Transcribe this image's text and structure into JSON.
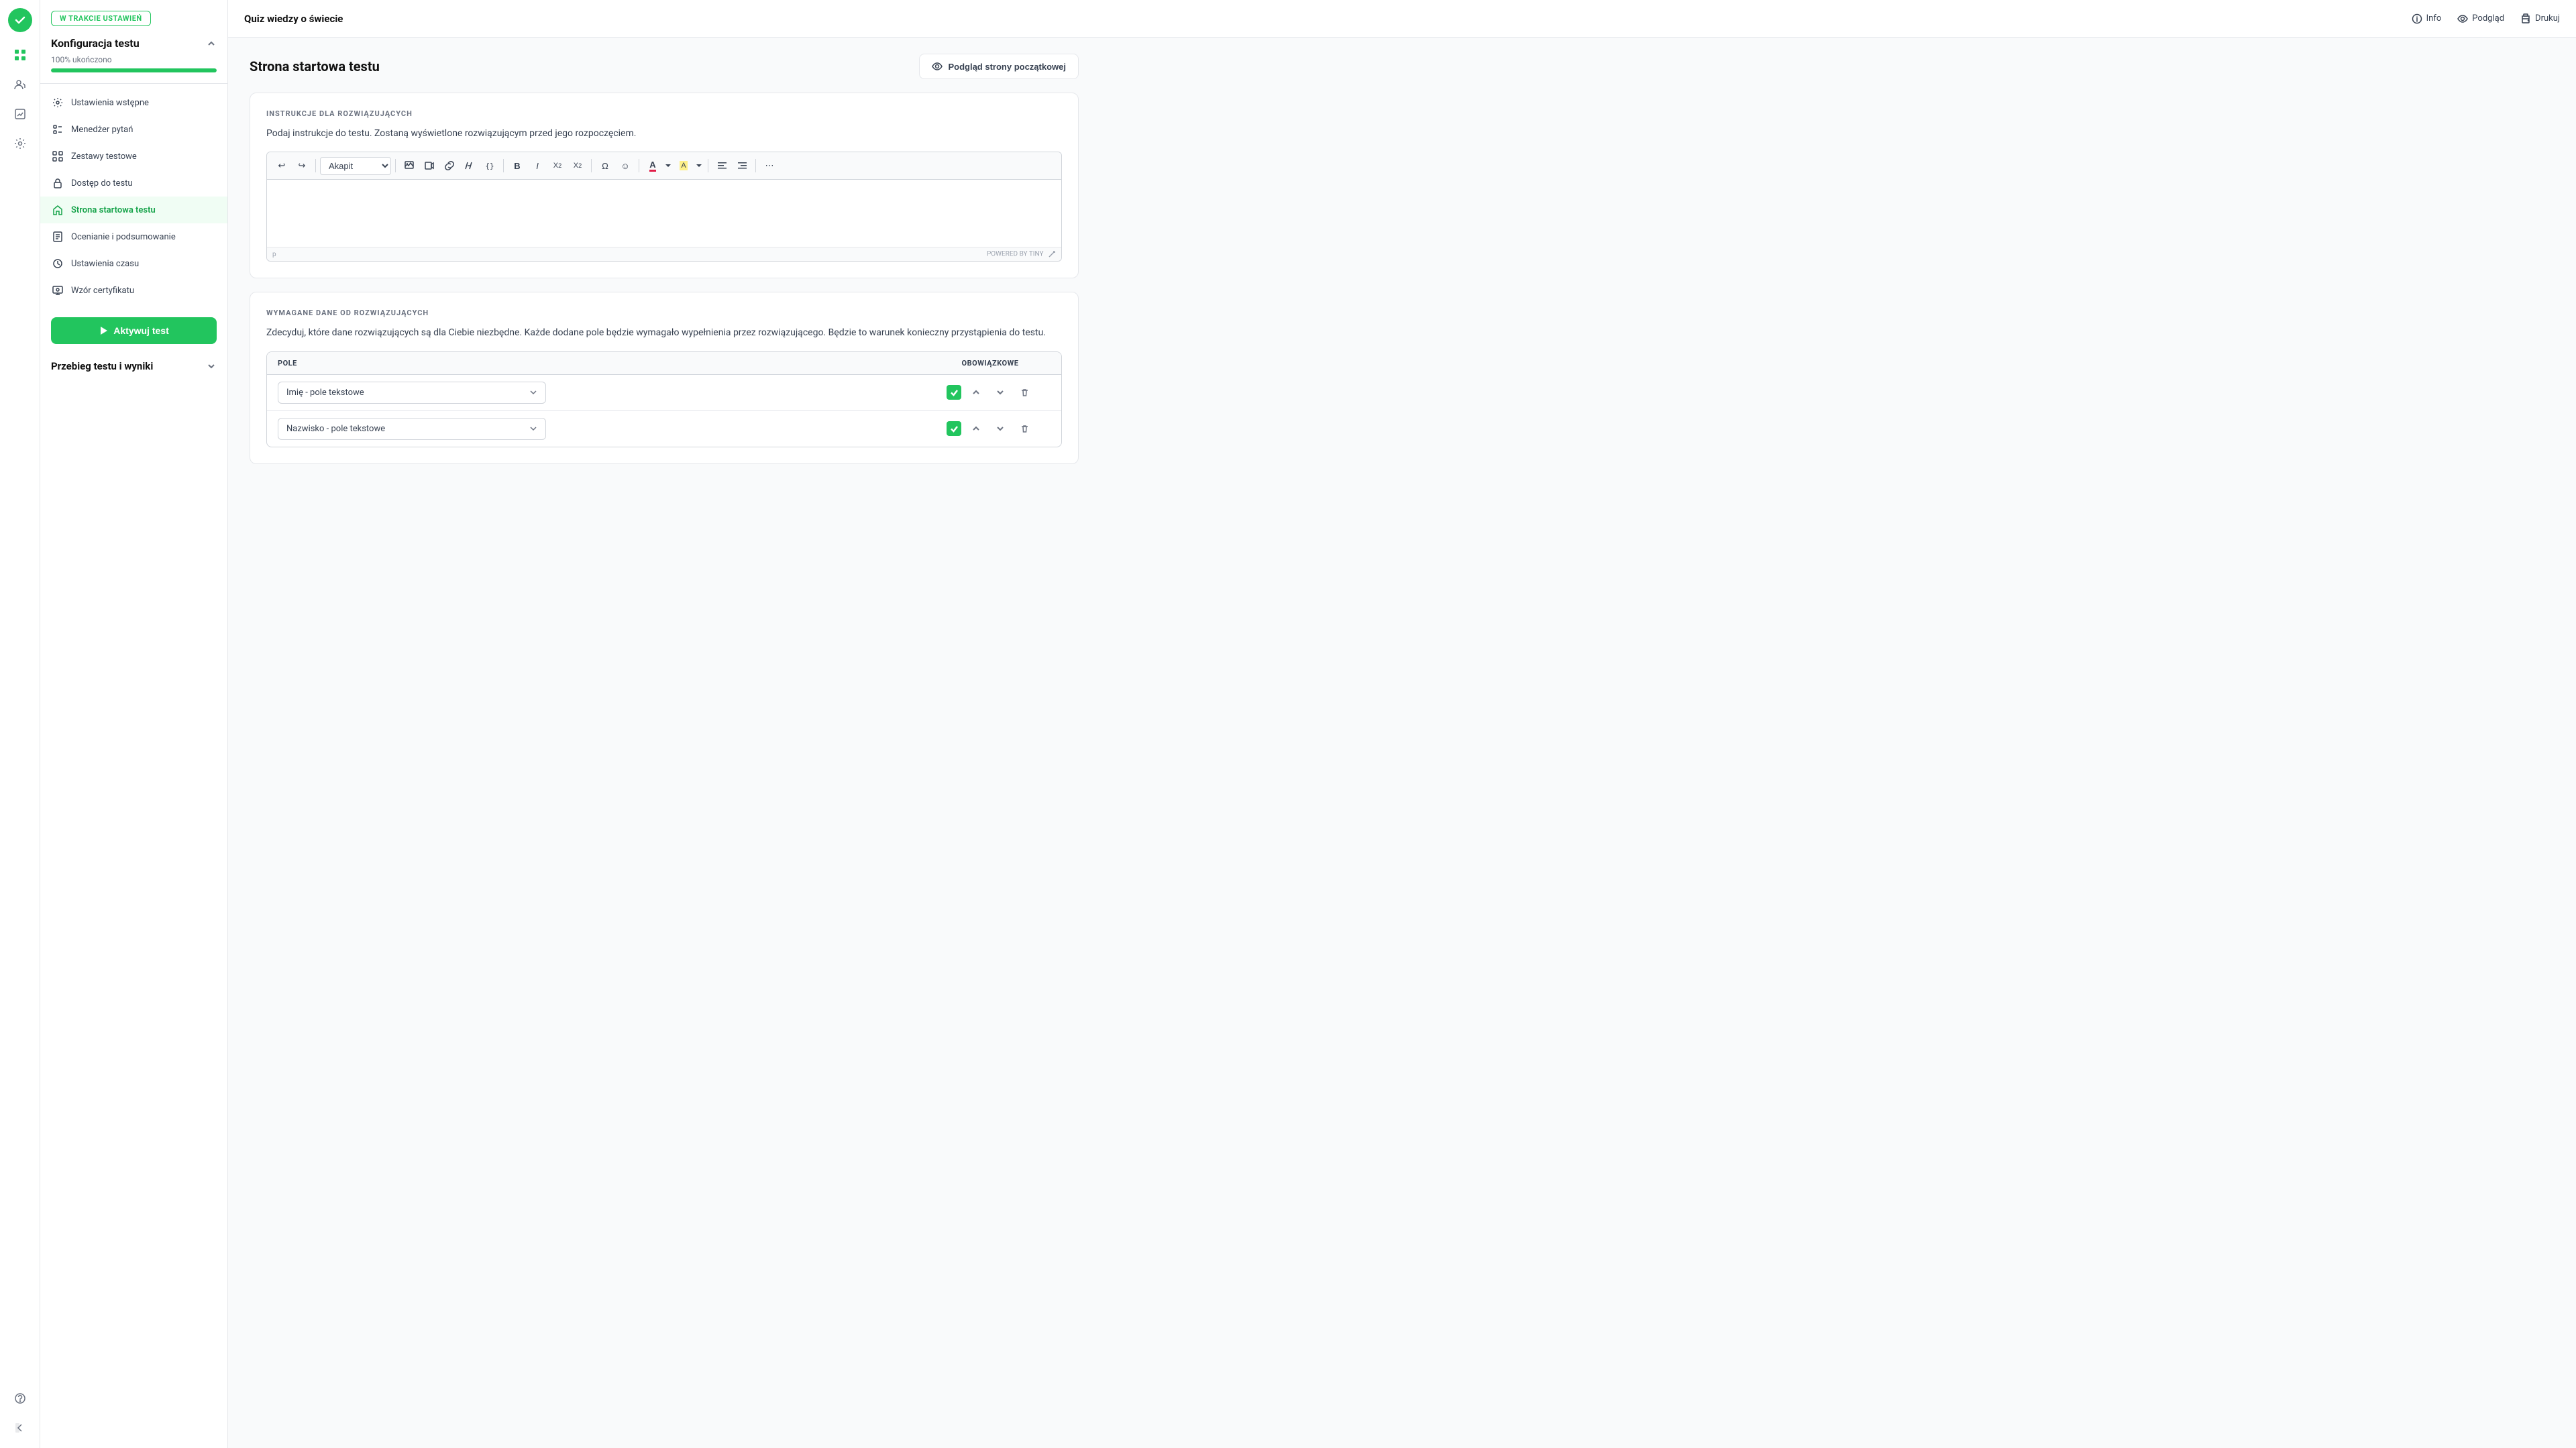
{
  "app": {
    "title": "Quiz wiedzy o świecie"
  },
  "header": {
    "info_label": "Info",
    "preview_label": "Podgląd",
    "print_label": "Drukuj"
  },
  "status": {
    "badge_label": "W TRAKCIE USTAWIEŃ"
  },
  "sidebar": {
    "config_section_title": "Konfiguracja testu",
    "progress_label": "100% ukończono",
    "progress_value": 100,
    "nav_items": [
      {
        "id": "ustawienia-wstepne",
        "label": "Ustawienia wstępne",
        "icon": "settings"
      },
      {
        "id": "menedzer-pytan",
        "label": "Menedżer pytań",
        "icon": "list"
      },
      {
        "id": "zestawy-testowe",
        "label": "Zestawy testowe",
        "icon": "grid"
      },
      {
        "id": "dostep-do-testu",
        "label": "Dostęp do testu",
        "icon": "lock"
      },
      {
        "id": "strona-startowa-testu",
        "label": "Strona startowa testu",
        "icon": "home",
        "active": true
      },
      {
        "id": "ocenianie-i-podsumowanie",
        "label": "Ocenianie i podsumowanie",
        "icon": "document"
      },
      {
        "id": "ustawienia-czasu",
        "label": "Ustawienia czasu",
        "icon": "clock"
      },
      {
        "id": "wzor-certyfikatu",
        "label": "Wzór certyfikatu",
        "icon": "certificate"
      }
    ],
    "activate_btn_label": "Aktywuj test",
    "results_section_title": "Przebieg testu i wyniki"
  },
  "page": {
    "title": "Strona startowa testu",
    "preview_btn_label": "Podgląd strony początkowej"
  },
  "instructions_section": {
    "label": "INSTRUKCJE DLA ROZWIĄZUJĄCYCH",
    "description": "Podaj instrukcje do testu. Zostaną wyświetlone rozwiązującym przed jego rozpoczęciem.",
    "editor": {
      "paragraph_label": "Akapit",
      "powered_by": "POWERED BY TINY",
      "p_indicator": "p"
    }
  },
  "required_data_section": {
    "label": "WYMAGANE DANE OD ROZWIĄZUJĄCYCH",
    "description": "Zdecyduj, które dane rozwiązujących są dla Ciebie niezbędne. Każde dodane pole będzie wymagało wypełnienia przez rozwiązującego. Będzie to warunek konieczny przystąpienia do testu.",
    "table": {
      "col_field": "POLE",
      "col_required": "OBOWIĄZKOWE",
      "rows": [
        {
          "field_label": "Imię - pole tekstowe",
          "required": true
        },
        {
          "field_label": "Nazwisko - pole tekstowe",
          "required": true
        }
      ]
    }
  },
  "icons": {
    "logo": "✓",
    "grid": "⊞",
    "users": "👥",
    "analytics": "📊",
    "settings": "⚙",
    "question": "?",
    "back": "←",
    "expand": "»",
    "chevron_down": "▾",
    "chevron_up": "▴",
    "play": "▶",
    "check": "✓",
    "trash": "🗑",
    "info_circle": "ⓘ",
    "eye": "👁",
    "print": "🖨",
    "image": "🖼",
    "video": "▶",
    "link": "🔗",
    "math": "√",
    "code": "{}",
    "bold": "B",
    "italic": "I",
    "sub": "X₂",
    "sup": "X²",
    "omega": "Ω",
    "emoji": "☺",
    "font_color": "A",
    "highlight": "▲",
    "align_left": "≡",
    "align_right": "≡",
    "more": "⋯",
    "undo": "↩",
    "redo": "↪",
    "chevron_right": "›",
    "resize": "⤢"
  }
}
